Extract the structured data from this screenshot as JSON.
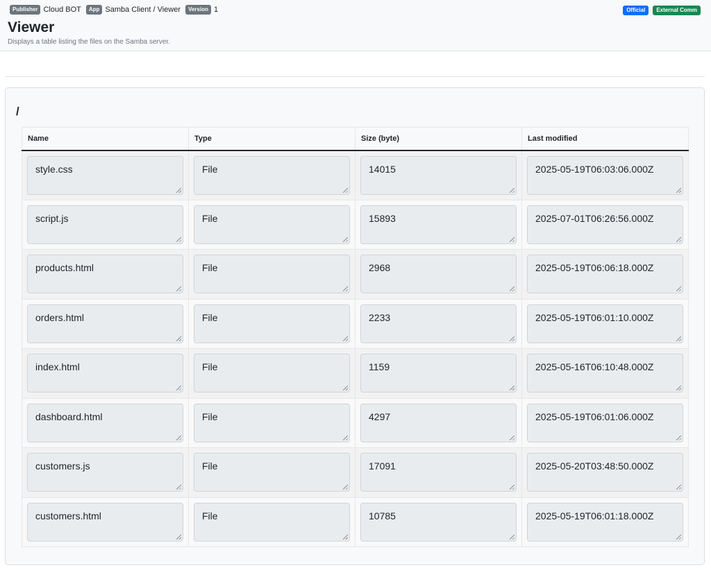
{
  "header": {
    "publisher_badge": "Publisher",
    "publisher": "Cloud BOT",
    "app_badge": "App",
    "app": "Samba Client / Viewer",
    "version_badge": "Version",
    "version": "1",
    "official_badge": "Official",
    "external_badge": "External Comm",
    "title": "Viewer",
    "description": "Displays a table listing the files on the Samba server."
  },
  "path": "/",
  "table": {
    "columns": [
      "Name",
      "Type",
      "Size (byte)",
      "Last modified"
    ],
    "rows": [
      [
        "style.css",
        "File",
        "14015",
        "2025-05-19T06:03:06.000Z"
      ],
      [
        "script.js",
        "File",
        "15893",
        "2025-07-01T06:26:56.000Z"
      ],
      [
        "products.html",
        "File",
        "2968",
        "2025-05-19T06:06:18.000Z"
      ],
      [
        "orders.html",
        "File",
        "2233",
        "2025-05-19T06:01:10.000Z"
      ],
      [
        "index.html",
        "File",
        "1159",
        "2025-05-16T06:10:48.000Z"
      ],
      [
        "dashboard.html",
        "File",
        "4297",
        "2025-05-19T06:01:06.000Z"
      ],
      [
        "customers.js",
        "File",
        "17091",
        "2025-05-20T03:48:50.000Z"
      ],
      [
        "customers.html",
        "File",
        "10785",
        "2025-05-19T06:01:18.000Z"
      ]
    ]
  },
  "colors": {
    "official": "#0d6efd",
    "external": "#198754",
    "badge_gray": "#6c757d"
  }
}
